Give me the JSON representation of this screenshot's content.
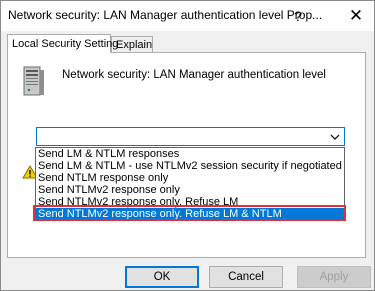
{
  "window": {
    "title": "Network security: LAN Manager authentication level Prop...",
    "help_glyph": "?",
    "close_glyph": "✕"
  },
  "tabs": [
    {
      "label": "Local Security Setting",
      "active": true
    },
    {
      "label": "Explain",
      "active": false
    }
  ],
  "policy": {
    "icon": "server-icon",
    "label": "Network security: LAN Manager authentication level"
  },
  "combo": {
    "value": "",
    "arrow_icon": "chevron-down-icon"
  },
  "warning": {
    "icon": "warning-icon"
  },
  "dropdown": {
    "options": [
      "Send LM & NTLM responses",
      "Send LM & NTLM - use NTLMv2 session security if negotiated",
      "Send NTLM response only",
      "Send NTLMv2 response only",
      "Send NTLMv2 response only. Refuse LM",
      "Send NTLMv2 response only. Refuse LM & NTLM"
    ],
    "selected_index": 5
  },
  "buttons": {
    "ok": "OK",
    "cancel": "Cancel",
    "apply": "Apply"
  },
  "colors": {
    "accent": "#0078d7",
    "highlight_border": "#e0303a"
  }
}
